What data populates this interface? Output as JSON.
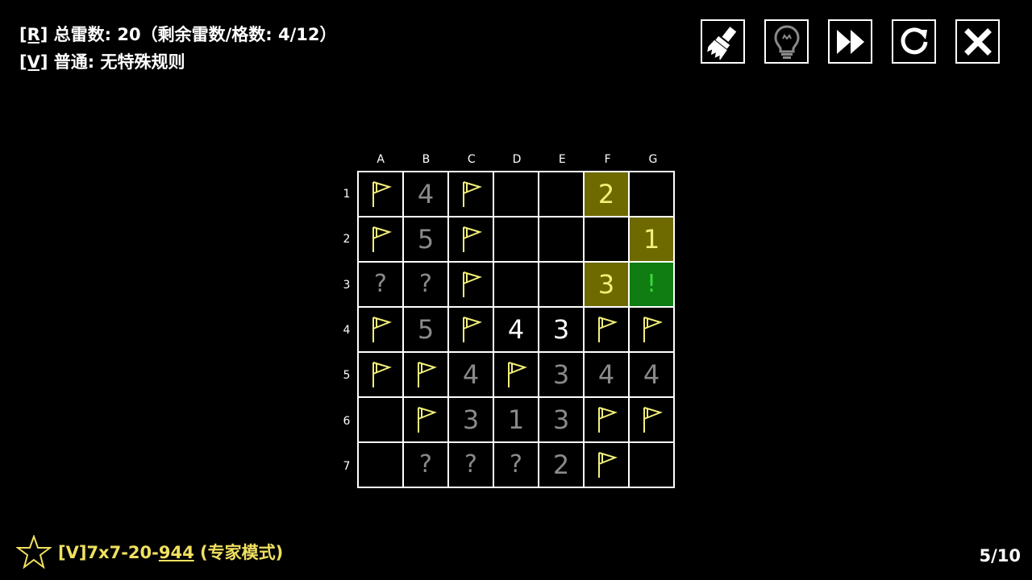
{
  "rules": {
    "line1_tag": "[R]",
    "line1_text": " 总雷数:  20（剩余雷数/格数: 4/12）",
    "line2_tag": "[V]",
    "line2_text": " 普通: 无特殊规则"
  },
  "toolbar": {
    "buttons": [
      {
        "name": "brush-button",
        "icon": "brush-icon"
      },
      {
        "name": "hint-button",
        "icon": "lightbulb-icon"
      },
      {
        "name": "fast-forward-button",
        "icon": "fast-forward-icon"
      },
      {
        "name": "restart-button",
        "icon": "restart-icon"
      },
      {
        "name": "close-button",
        "icon": "close-icon"
      }
    ]
  },
  "board": {
    "columns": [
      "A",
      "B",
      "C",
      "D",
      "E",
      "F",
      "G"
    ],
    "rows": [
      "1",
      "2",
      "3",
      "4",
      "5",
      "6",
      "7"
    ],
    "cells": [
      [
        {
          "t": "flag"
        },
        {
          "t": "num",
          "v": "4",
          "c": "gray"
        },
        {
          "t": "flag"
        },
        {
          "t": "empty"
        },
        {
          "t": "empty"
        },
        {
          "t": "num",
          "v": "2",
          "c": "yellow"
        },
        {
          "t": "empty"
        }
      ],
      [
        {
          "t": "flag"
        },
        {
          "t": "num",
          "v": "5",
          "c": "gray"
        },
        {
          "t": "flag"
        },
        {
          "t": "empty"
        },
        {
          "t": "empty"
        },
        {
          "t": "empty"
        },
        {
          "t": "num",
          "v": "1",
          "c": "yellow"
        }
      ],
      [
        {
          "t": "q",
          "v": "?"
        },
        {
          "t": "q",
          "v": "?"
        },
        {
          "t": "flag"
        },
        {
          "t": "empty"
        },
        {
          "t": "empty"
        },
        {
          "t": "num",
          "v": "3",
          "c": "yellow"
        },
        {
          "t": "excl",
          "v": "!"
        }
      ],
      [
        {
          "t": "flag"
        },
        {
          "t": "num",
          "v": "5",
          "c": "gray"
        },
        {
          "t": "flag"
        },
        {
          "t": "num",
          "v": "4",
          "c": "white"
        },
        {
          "t": "num",
          "v": "3",
          "c": "white"
        },
        {
          "t": "flag"
        },
        {
          "t": "flag"
        }
      ],
      [
        {
          "t": "flag"
        },
        {
          "t": "flag"
        },
        {
          "t": "num",
          "v": "4",
          "c": "gray"
        },
        {
          "t": "flag"
        },
        {
          "t": "num",
          "v": "3",
          "c": "gray"
        },
        {
          "t": "num",
          "v": "4",
          "c": "gray"
        },
        {
          "t": "num",
          "v": "4",
          "c": "gray"
        }
      ],
      [
        {
          "t": "empty"
        },
        {
          "t": "flag"
        },
        {
          "t": "num",
          "v": "3",
          "c": "gray"
        },
        {
          "t": "num",
          "v": "1",
          "c": "gray"
        },
        {
          "t": "num",
          "v": "3",
          "c": "gray"
        },
        {
          "t": "flag"
        },
        {
          "t": "flag"
        }
      ],
      [
        {
          "t": "empty"
        },
        {
          "t": "q",
          "v": "?"
        },
        {
          "t": "q",
          "v": "?"
        },
        {
          "t": "q",
          "v": "?"
        },
        {
          "t": "num",
          "v": "2",
          "c": "gray"
        },
        {
          "t": "flag"
        },
        {
          "t": "empty"
        }
      ]
    ]
  },
  "footer": {
    "puzzle_prefix": "[V]7x7-20-",
    "puzzle_id": "944",
    "puzzle_suffix": " (专家模式)",
    "progress": "5/10"
  },
  "colors": {
    "flag": "#f3f07a",
    "highlight": "#6e6a00",
    "safe_green": "#0f7d12",
    "footer_text": "#f0e060"
  }
}
